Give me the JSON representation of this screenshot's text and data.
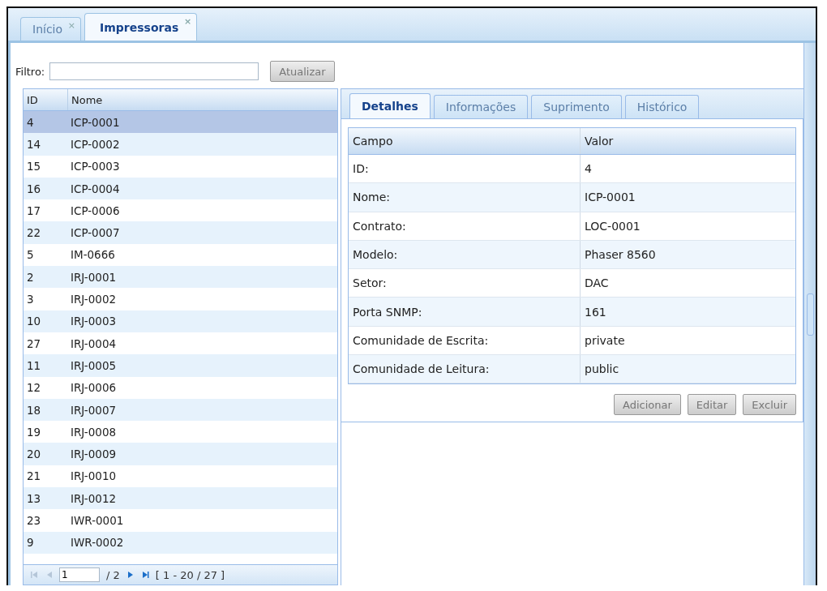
{
  "tabs": [
    {
      "label": "Início",
      "close": "×",
      "selected": false
    },
    {
      "label": "Impressoras",
      "close": "×",
      "selected": true
    }
  ],
  "filter": {
    "label": "Filtro:",
    "button": {
      "label": "Atualizar",
      "disabled": true
    }
  },
  "grid": {
    "columns": [
      "ID",
      "Nome"
    ],
    "rows": [
      {
        "id": "4",
        "name": "ICP-0001",
        "selected": true
      },
      {
        "id": "14",
        "name": "ICP-0002",
        "selected": false
      },
      {
        "id": "15",
        "name": "ICP-0003",
        "selected": false
      },
      {
        "id": "16",
        "name": "ICP-0004",
        "selected": false
      },
      {
        "id": "17",
        "name": "ICP-0006",
        "selected": false
      },
      {
        "id": "22",
        "name": "ICP-0007",
        "selected": false
      },
      {
        "id": "5",
        "name": "IM-0666",
        "selected": false
      },
      {
        "id": "2",
        "name": "IRJ-0001",
        "selected": false
      },
      {
        "id": "3",
        "name": "IRJ-0002",
        "selected": false
      },
      {
        "id": "10",
        "name": "IRJ-0003",
        "selected": false
      },
      {
        "id": "27",
        "name": "IRJ-0004",
        "selected": false
      },
      {
        "id": "11",
        "name": "IRJ-0005",
        "selected": false
      },
      {
        "id": "12",
        "name": "IRJ-0006",
        "selected": false
      },
      {
        "id": "18",
        "name": "IRJ-0007",
        "selected": false
      },
      {
        "id": "19",
        "name": "IRJ-0008",
        "selected": false
      },
      {
        "id": "20",
        "name": "IRJ-0009",
        "selected": false
      },
      {
        "id": "21",
        "name": "IRJ-0010",
        "selected": false
      },
      {
        "id": "13",
        "name": "IRJ-0012",
        "selected": false
      },
      {
        "id": "23",
        "name": "IWR-0001",
        "selected": false
      },
      {
        "id": "9",
        "name": "IWR-0002",
        "selected": false
      }
    ],
    "pager": {
      "page": "1",
      "pages": "/ 2",
      "range": "[ 1 - 20 / 27 ]",
      "first_disabled": true,
      "prev_disabled": true,
      "next_disabled": false,
      "last_disabled": false
    }
  },
  "detail_tabs": [
    {
      "label": "Detalhes",
      "selected": true
    },
    {
      "label": "Informações",
      "selected": false
    },
    {
      "label": "Suprimento",
      "selected": false
    },
    {
      "label": "Histórico",
      "selected": false
    }
  ],
  "details": {
    "columns": [
      "Campo",
      "Valor"
    ],
    "rows": [
      [
        "ID:",
        "4"
      ],
      [
        "Nome:",
        "ICP-0001"
      ],
      [
        "Contrato:",
        "LOC-0001"
      ],
      [
        "Modelo:",
        "Phaser 8560"
      ],
      [
        "Setor:",
        "DAC"
      ],
      [
        "Porta SNMP:",
        "161"
      ],
      [
        "Comunidade de Escrita:",
        "private"
      ],
      [
        "Comunidade de Leitura:",
        "public"
      ]
    ]
  },
  "buttons": [
    {
      "label": "Adicionar",
      "disabled": true
    },
    {
      "label": "Editar",
      "disabled": true
    },
    {
      "label": "Excluir",
      "disabled": true
    }
  ]
}
